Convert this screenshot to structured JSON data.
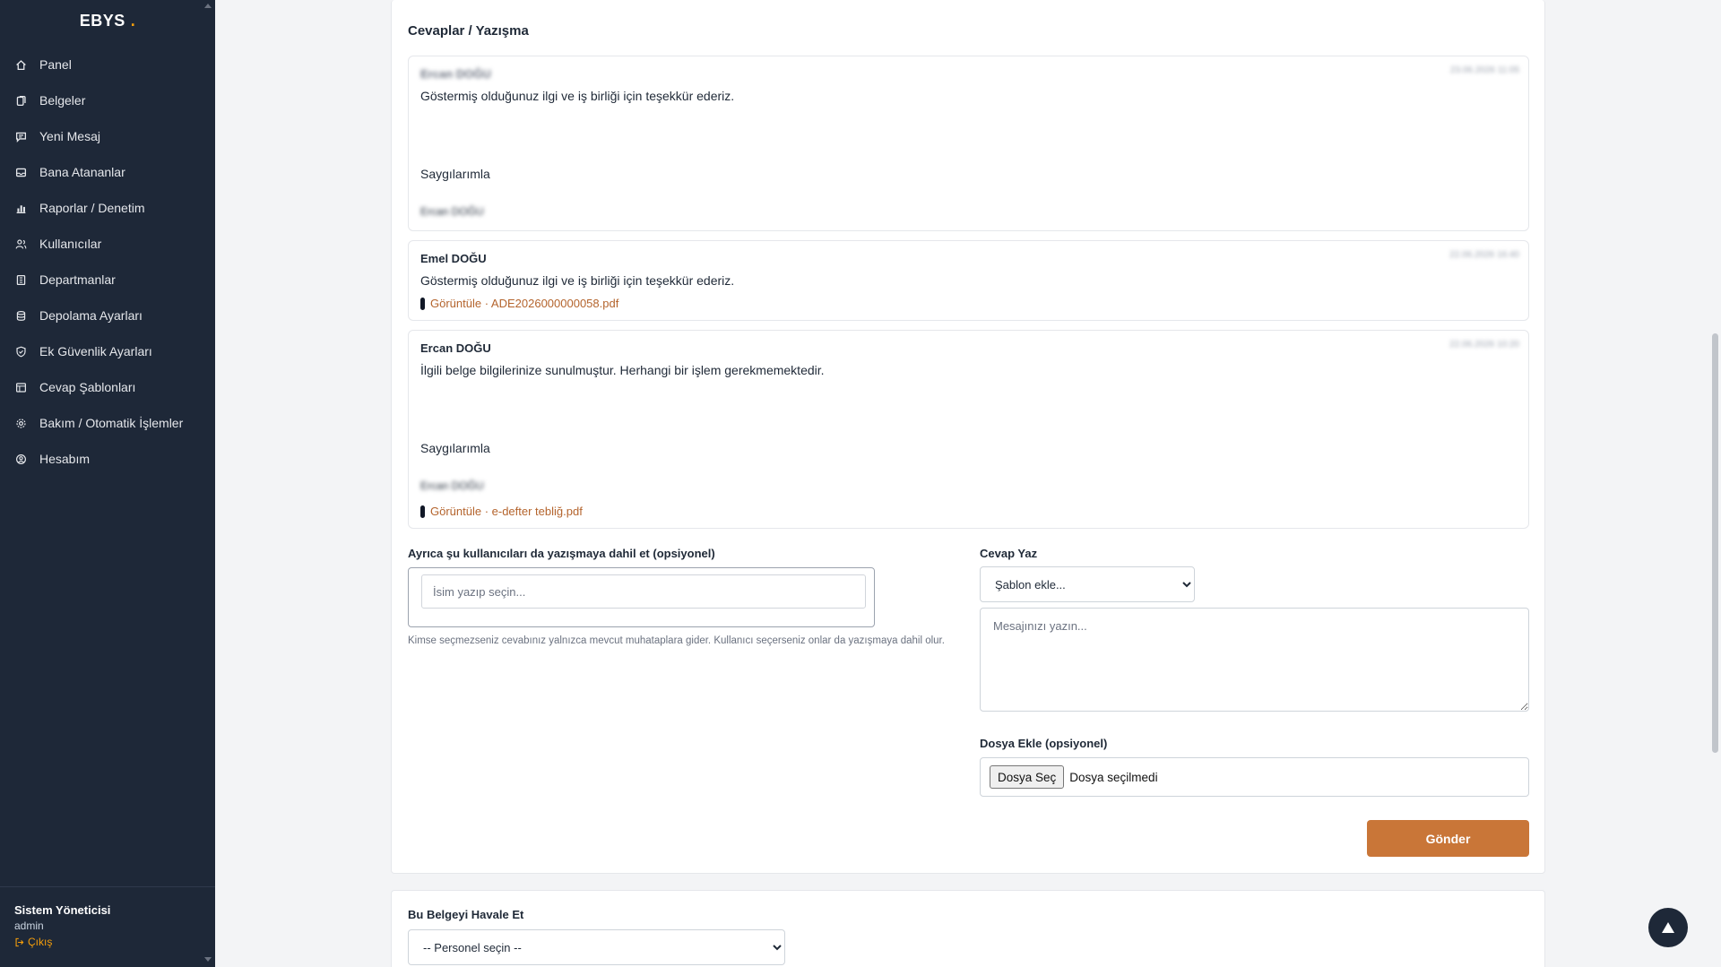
{
  "sidebar": {
    "brand": "EBYS",
    "brand_dot": ".",
    "items": [
      {
        "label": "Panel",
        "icon": "home-icon"
      },
      {
        "label": "Belgeler",
        "icon": "documents-icon"
      },
      {
        "label": "Yeni Mesaj",
        "icon": "message-icon"
      },
      {
        "label": "Bana Atananlar",
        "icon": "inbox-icon"
      },
      {
        "label": "Raporlar / Denetim",
        "icon": "bar-chart-icon"
      },
      {
        "label": "Kullanıcılar",
        "icon": "users-icon"
      },
      {
        "label": "Departmanlar",
        "icon": "building-icon"
      },
      {
        "label": "Depolama Ayarları",
        "icon": "database-icon"
      },
      {
        "label": "Ek Güvenlik Ayarları",
        "icon": "shield-icon"
      },
      {
        "label": "Cevap Şablonları",
        "icon": "template-icon"
      },
      {
        "label": "Bakım / Otomatik İşlemler",
        "icon": "gear-icon"
      },
      {
        "label": "Hesabım",
        "icon": "user-circle-icon"
      }
    ],
    "footer": {
      "user_name": "Sistem Yöneticisi",
      "user_role": "admin",
      "logout": "Çıkış"
    }
  },
  "replies": {
    "title": "Cevaplar / Yazışma",
    "messages": [
      {
        "author": "Ercan DOĞU",
        "time": "23.06.2026 11:05",
        "body": "Göstermiş olduğunuz ilgi ve iş birliği için teşekkür ederiz.",
        "closing": "Saygılarımla",
        "signature": "Ercan DOĞU",
        "attachment": ""
      },
      {
        "author": "Emel DOĞU",
        "time": "22.06.2026 16:40",
        "body": "Göstermiş olduğunuz ilgi ve iş birliği için teşekkür ederiz.",
        "closing": "",
        "signature": "",
        "attachment": "Görüntüle · ADE2026000000058.pdf"
      },
      {
        "author": "Ercan DOĞU",
        "time": "22.06.2026 10:20",
        "body": "İlgili belge bilgilerinize sunulmuştur. Herhangi bir işlem gerekmemektedir.",
        "closing": "Saygılarımla",
        "signature": "Ercan DOĞU",
        "attachment": "Görüntüle · e-defter tebliğ.pdf"
      }
    ]
  },
  "cc": {
    "label": "Ayrıca şu kullanıcıları da yazışmaya dahil et (opsiyonel)",
    "placeholder": "İsim yazıp seçin...",
    "help": "Kimse seçmezseniz cevabınız yalnızca mevcut muhataplara gider. Kullanıcı seçerseniz onlar da yazışmaya dahil olur."
  },
  "reply_form": {
    "label": "Cevap Yaz",
    "template_selected": "Şablon ekle...",
    "message_placeholder": "Mesajınızı yazın...",
    "file_label": "Dosya Ekle (opsiyonel)",
    "file_button": "Dosya Seç",
    "file_none": "Dosya seçilmedi",
    "send": "Gönder"
  },
  "forward": {
    "label": "Bu Belgeyi Havale Et",
    "selected": "-- Personel seçin --"
  },
  "colors": {
    "sidebar_bg": "#1e2838",
    "accent": "#c97638",
    "link": "#b4642d",
    "brand_dot": "#f59e0b"
  }
}
